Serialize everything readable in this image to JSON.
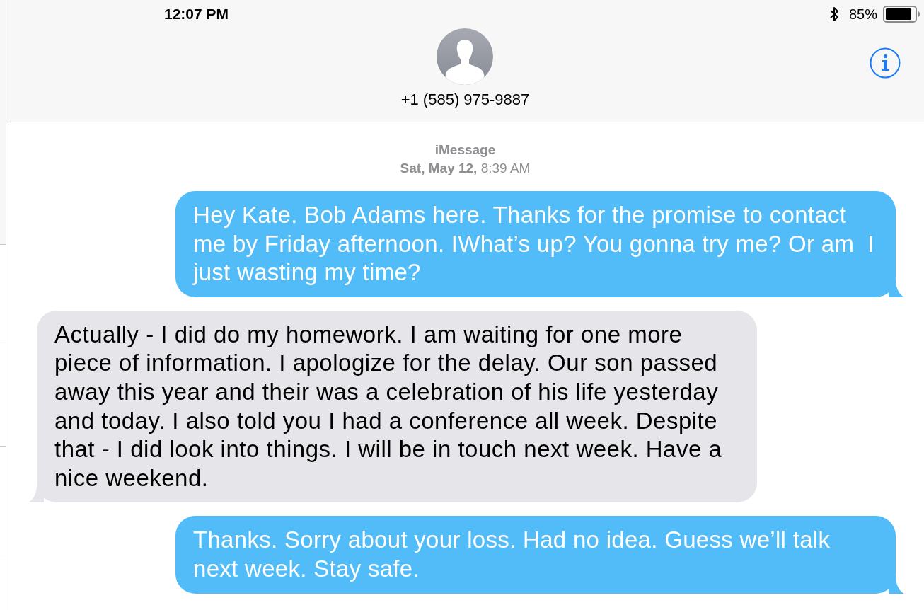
{
  "status_bar": {
    "time": "12:07 PM",
    "battery": "85%"
  },
  "header": {
    "contact": "+1 (585) 975-9887"
  },
  "conversation": {
    "service": "iMessage",
    "timestamp": "**Sat, May 12,** 8:39 AM",
    "messages": [
      {
        "kind": "sent",
        "text": "Hey Kate. Bob Adams here. Thanks for the promise to contact me by Friday afternoon. IWhat’s up? You gonna try me? Or am  I just wasting my time?"
      },
      {
        "kind": "received",
        "text": "Actually - I did do my homework. I am waiting for one more piece of information. I apologize for the delay. Our son passed away this year and their was a celebration of his life yesterday and today. I also told you I had a conference all week. Despite that - I did look into things. I will be in touch next week. Have a nice weekend."
      },
      {
        "kind": "sent",
        "text": "Thanks. Sorry about your loss. Had no idea. Guess we’ll talk next week. Stay safe."
      }
    ]
  }
}
